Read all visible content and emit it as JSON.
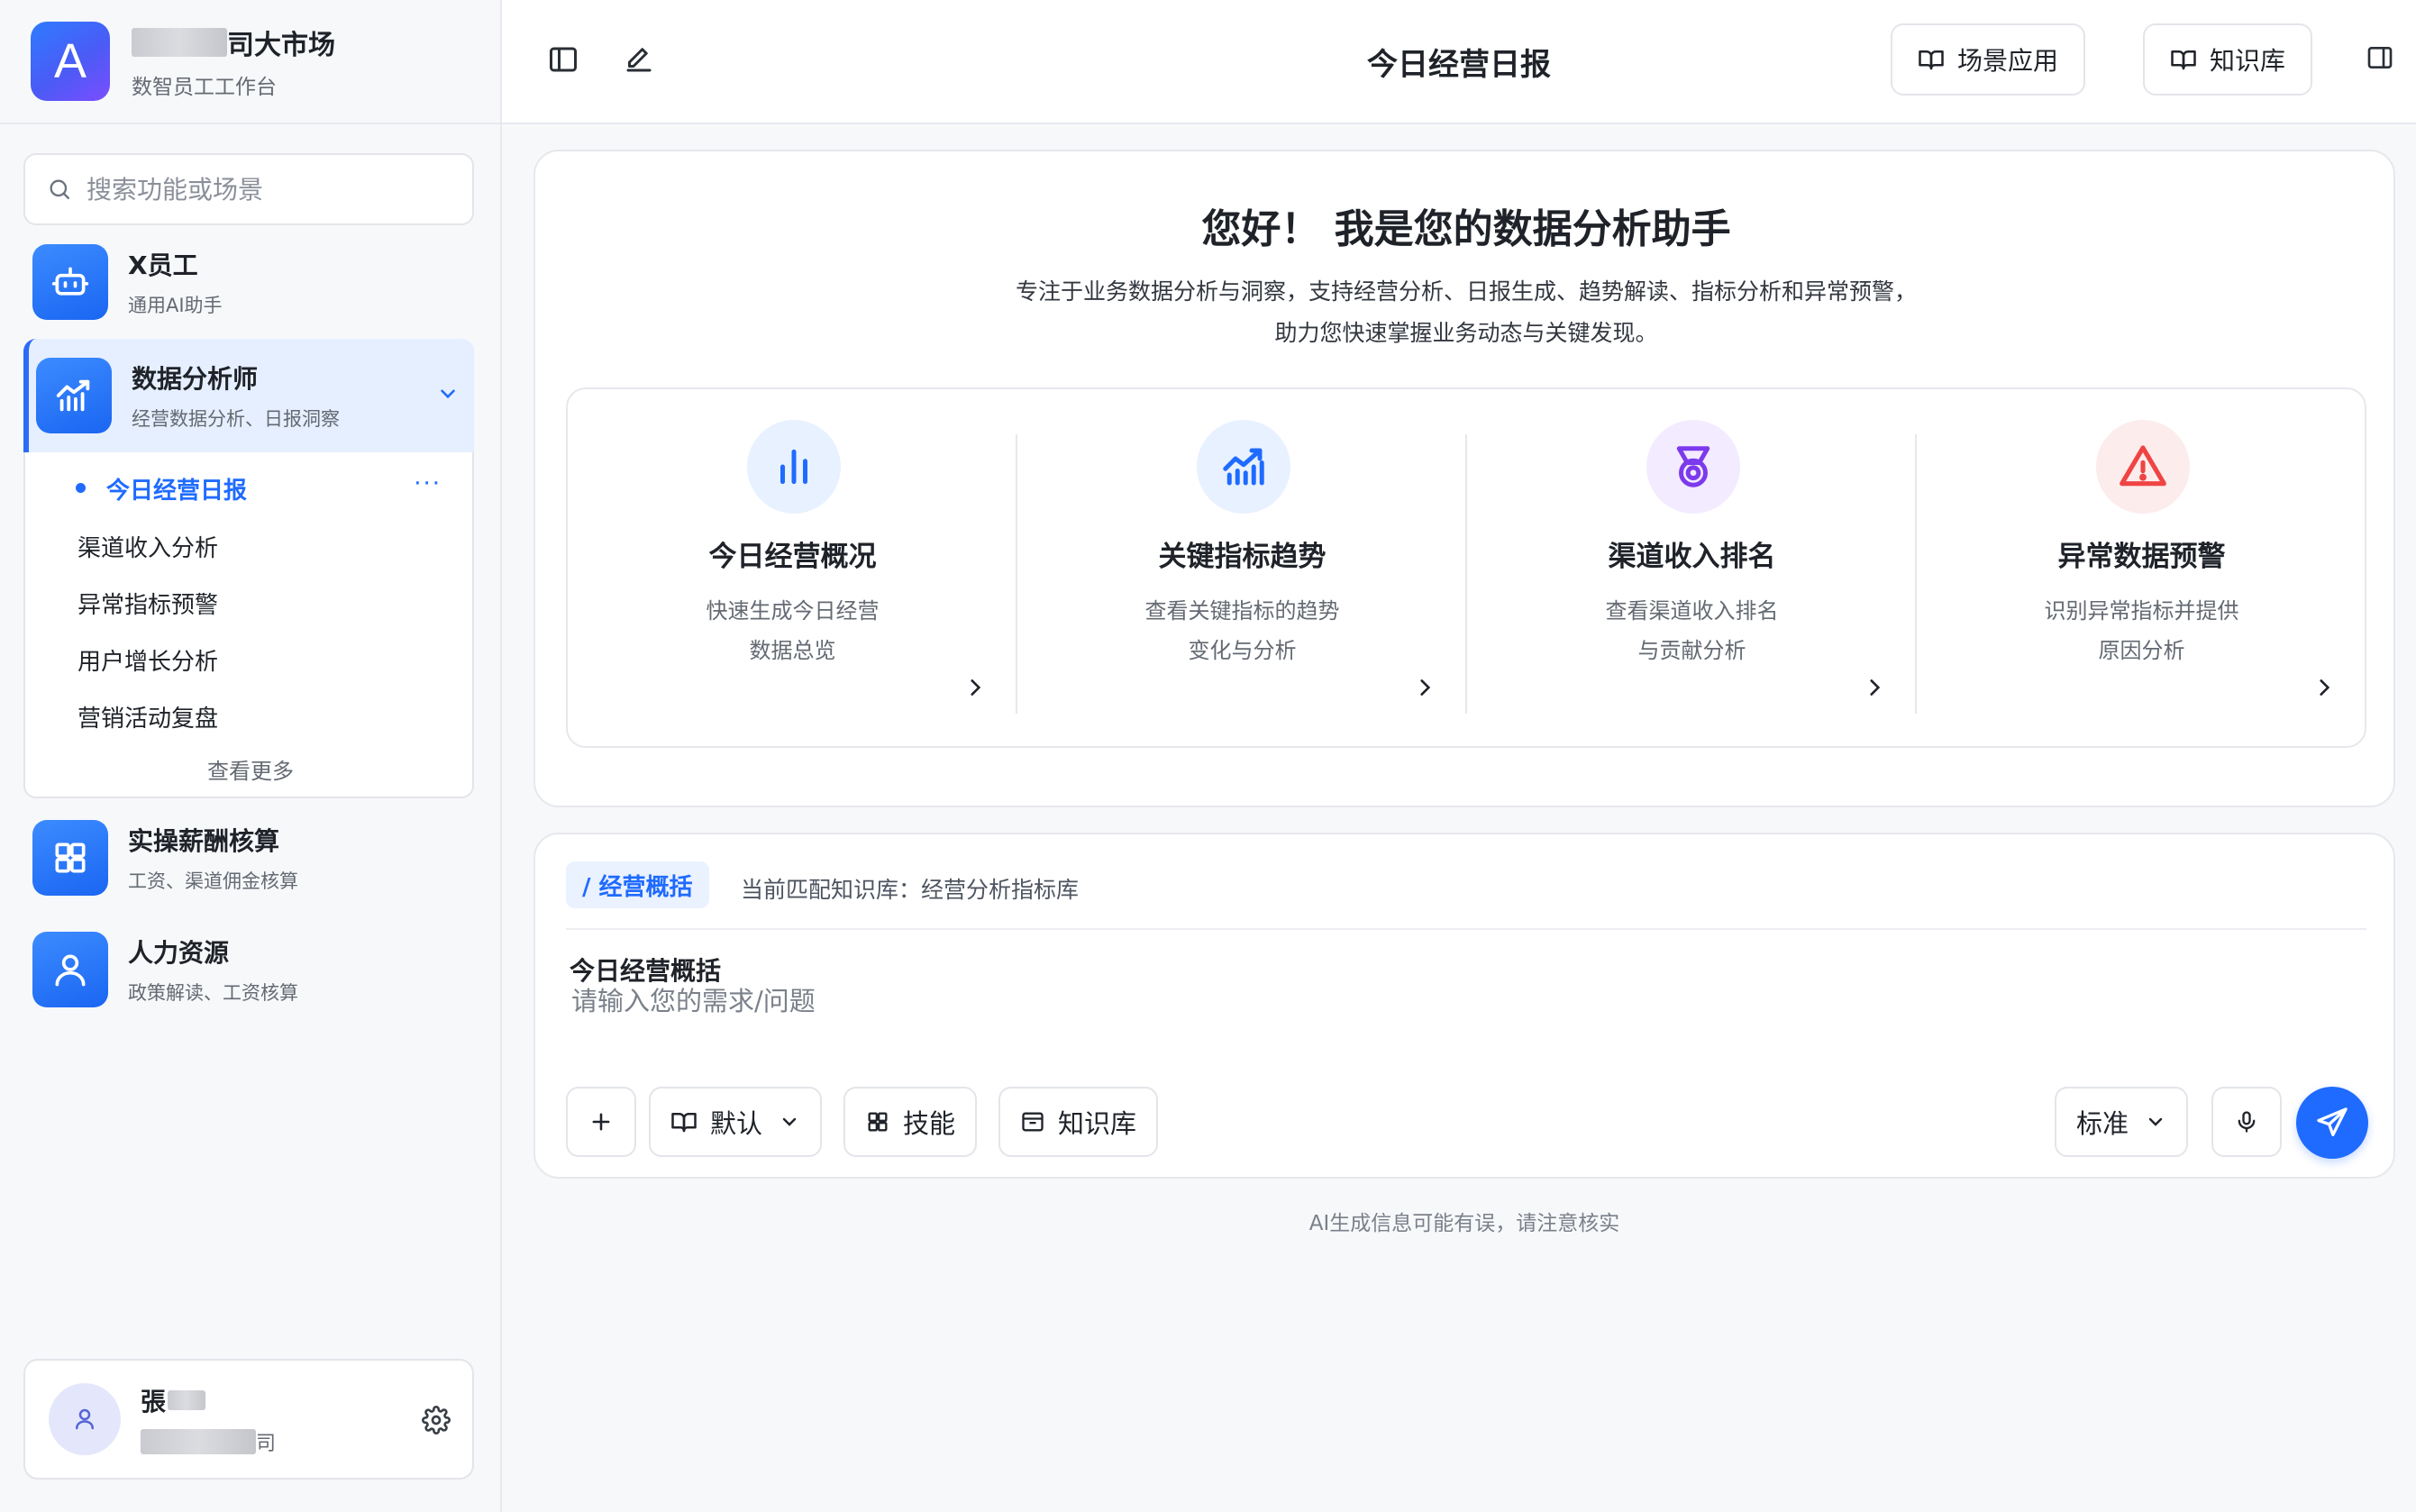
{
  "colors": {
    "accent": "#1f6bff",
    "sidebar_active_bg": "#e6efff",
    "danger": "#ef4444",
    "purple": "#7c3aed"
  },
  "brand": {
    "logo_letter": "A",
    "name_suffix": "司大市场",
    "subtitle": "数智员工工作台"
  },
  "sidebar": {
    "search_placeholder": "搜索功能或场景",
    "agents": [
      {
        "title": "X员工",
        "subtitle": "通用AI助手",
        "icon": "robot-icon"
      },
      {
        "title": "数据分析师",
        "subtitle": "经营数据分析、日报洞察",
        "icon": "chart-growth-icon"
      },
      {
        "title": "实操薪酬核算",
        "subtitle": "工资、渠道佣金核算",
        "icon": "grid-apps-icon"
      },
      {
        "title": "人力资源",
        "subtitle": "政策解读、工资核算",
        "icon": "user-icon"
      }
    ],
    "sub_items": [
      "今日经营日报",
      "渠道收入分析",
      "异常指标预警",
      "用户增长分析",
      "营销活动复盘"
    ],
    "more_dots": "···",
    "see_more": "查看更多"
  },
  "user": {
    "name_initial": "張",
    "org_suffix": "司"
  },
  "topbar": {
    "title": "今日经营日报",
    "scene_app": "场景应用",
    "knowledge_base": "知识库"
  },
  "welcome": {
    "title": "您好！  我是您的数据分析助手",
    "desc_line1": "专注于业务数据分析与洞察，支持经营分析、日报生成、趋势解读、指标分析和异常预警，",
    "desc_line2": "助力您快速掌握业务动态与关键发现。",
    "features": [
      {
        "title": "今日经营概况",
        "desc1": "快速生成今日经营",
        "desc2": "数据总览",
        "icon": "bar-chart-icon"
      },
      {
        "title": "关键指标趋势",
        "desc1": "查看关键指标的趋势",
        "desc2": "变化与分析",
        "icon": "trend-chart-icon"
      },
      {
        "title": "渠道收入排名",
        "desc1": "查看渠道收入排名",
        "desc2": "与贡献分析",
        "icon": "medal-icon"
      },
      {
        "title": "异常数据预警",
        "desc1": "识别异常指标并提供",
        "desc2": "原因分析",
        "icon": "warning-icon"
      }
    ]
  },
  "composer": {
    "tag": "/ 经营概括",
    "kb_note": "当前匹配知识库：经营分析指标库",
    "prompt_title": "今日经营概括",
    "placeholder": "请输入您的需求/问题",
    "default_label": "默认",
    "skills_label": "技能",
    "kb_label": "知识库",
    "mode_label": "标准"
  },
  "disclaimer": "AI生成信息可能有误，请注意核实"
}
